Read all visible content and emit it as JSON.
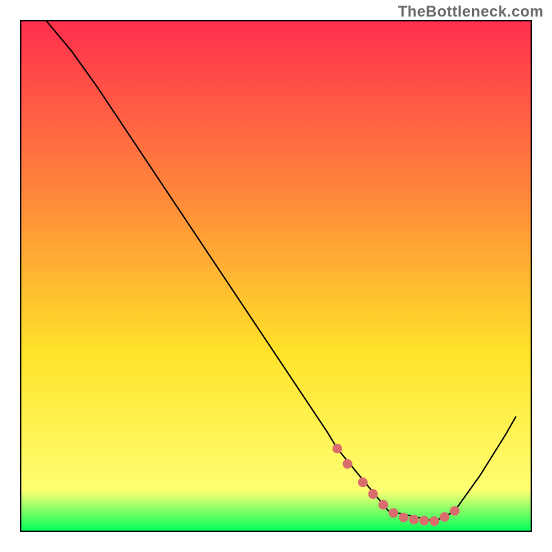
{
  "watermark": "TheBottleneck.com",
  "chart_data": {
    "type": "line",
    "title": "",
    "xlabel": "",
    "ylabel": "",
    "xlim": [
      0,
      100
    ],
    "ylim": [
      0,
      100
    ],
    "grid": false,
    "legend": false,
    "annotations": [],
    "background_gradient": {
      "top": "#ff2f4d",
      "mid1": "#ff8a3a",
      "mid2": "#ffe329",
      "mid3": "#ffff73",
      "bottom": "#00ff59"
    },
    "series": [
      {
        "name": "bottleneck-curve",
        "color": "#000000",
        "width": 2,
        "x": [
          5,
          10,
          15,
          20,
          25,
          30,
          35,
          40,
          45,
          50,
          55,
          60,
          62,
          72,
          81,
          83,
          85,
          90,
          95,
          97
        ],
        "values": [
          100,
          94,
          87,
          79.5,
          72,
          64.5,
          57,
          49.5,
          42,
          34.5,
          27,
          19.5,
          16.2,
          4,
          2,
          2.8,
          4,
          11,
          19,
          22.5
        ]
      },
      {
        "name": "highlight-dots",
        "color": "#d96d6d",
        "is_marker_series": true,
        "marker_radius": 7,
        "x": [
          62,
          64,
          67,
          69,
          71,
          73,
          75,
          77,
          79,
          81,
          83,
          85
        ],
        "values": [
          16.2,
          13.2,
          9.6,
          7.3,
          5.2,
          3.6,
          2.7,
          2.3,
          2.1,
          2.0,
          2.8,
          4.0
        ]
      }
    ]
  }
}
